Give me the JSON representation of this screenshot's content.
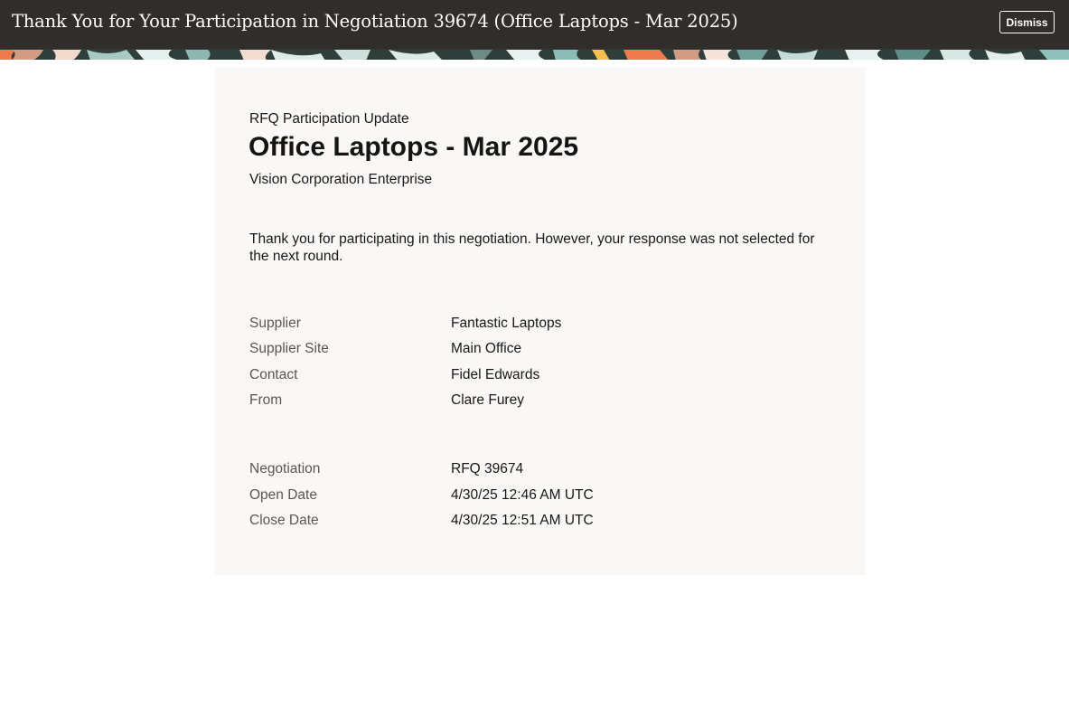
{
  "header": {
    "title": "Thank You for Your Participation in Negotiation 39674 (Office Laptops - Mar 2025)",
    "dismiss_label": "Dismiss",
    "background_color": "#312d2a"
  },
  "card": {
    "subtitle": "RFQ Participation Update",
    "headline": "Office Laptops - Mar 2025",
    "organization": "Vision Corporation Enterprise",
    "message": "Thank you for participating in this negotiation. However, your response was not selected for the next round.",
    "party_details": [
      {
        "label": "Supplier",
        "value": "Fantastic Laptops"
      },
      {
        "label": "Supplier Site",
        "value": "Main Office"
      },
      {
        "label": "Contact",
        "value": "Fidel Edwards"
      },
      {
        "label": "From",
        "value": "Clare Furey"
      }
    ],
    "negotiation_details": [
      {
        "label": "Negotiation",
        "value": "RFQ 39674"
      },
      {
        "label": "Open Date",
        "value": "4/30/25 12:46 AM UTC"
      },
      {
        "label": "Close Date",
        "value": "4/30/25 12:51 AM UTC"
      }
    ]
  }
}
